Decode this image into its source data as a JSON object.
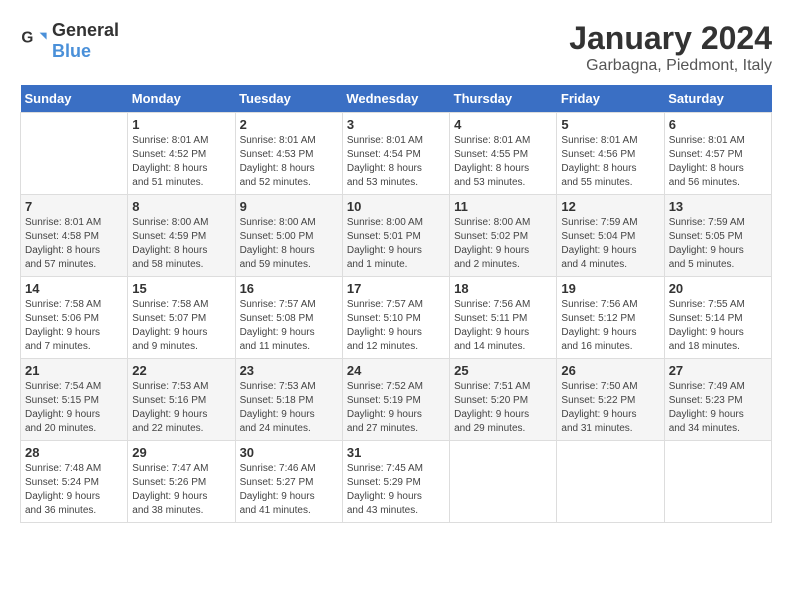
{
  "header": {
    "logo_general": "General",
    "logo_blue": "Blue",
    "month_title": "January 2024",
    "location": "Garbagna, Piedmont, Italy"
  },
  "weekdays": [
    "Sunday",
    "Monday",
    "Tuesday",
    "Wednesday",
    "Thursday",
    "Friday",
    "Saturday"
  ],
  "weeks": [
    [
      {
        "day": "",
        "info": ""
      },
      {
        "day": "1",
        "info": "Sunrise: 8:01 AM\nSunset: 4:52 PM\nDaylight: 8 hours\nand 51 minutes."
      },
      {
        "day": "2",
        "info": "Sunrise: 8:01 AM\nSunset: 4:53 PM\nDaylight: 8 hours\nand 52 minutes."
      },
      {
        "day": "3",
        "info": "Sunrise: 8:01 AM\nSunset: 4:54 PM\nDaylight: 8 hours\nand 53 minutes."
      },
      {
        "day": "4",
        "info": "Sunrise: 8:01 AM\nSunset: 4:55 PM\nDaylight: 8 hours\nand 53 minutes."
      },
      {
        "day": "5",
        "info": "Sunrise: 8:01 AM\nSunset: 4:56 PM\nDaylight: 8 hours\nand 55 minutes."
      },
      {
        "day": "6",
        "info": "Sunrise: 8:01 AM\nSunset: 4:57 PM\nDaylight: 8 hours\nand 56 minutes."
      }
    ],
    [
      {
        "day": "7",
        "info": "Sunrise: 8:01 AM\nSunset: 4:58 PM\nDaylight: 8 hours\nand 57 minutes."
      },
      {
        "day": "8",
        "info": "Sunrise: 8:00 AM\nSunset: 4:59 PM\nDaylight: 8 hours\nand 58 minutes."
      },
      {
        "day": "9",
        "info": "Sunrise: 8:00 AM\nSunset: 5:00 PM\nDaylight: 8 hours\nand 59 minutes."
      },
      {
        "day": "10",
        "info": "Sunrise: 8:00 AM\nSunset: 5:01 PM\nDaylight: 9 hours\nand 1 minute."
      },
      {
        "day": "11",
        "info": "Sunrise: 8:00 AM\nSunset: 5:02 PM\nDaylight: 9 hours\nand 2 minutes."
      },
      {
        "day": "12",
        "info": "Sunrise: 7:59 AM\nSunset: 5:04 PM\nDaylight: 9 hours\nand 4 minutes."
      },
      {
        "day": "13",
        "info": "Sunrise: 7:59 AM\nSunset: 5:05 PM\nDaylight: 9 hours\nand 5 minutes."
      }
    ],
    [
      {
        "day": "14",
        "info": "Sunrise: 7:58 AM\nSunset: 5:06 PM\nDaylight: 9 hours\nand 7 minutes."
      },
      {
        "day": "15",
        "info": "Sunrise: 7:58 AM\nSunset: 5:07 PM\nDaylight: 9 hours\nand 9 minutes."
      },
      {
        "day": "16",
        "info": "Sunrise: 7:57 AM\nSunset: 5:08 PM\nDaylight: 9 hours\nand 11 minutes."
      },
      {
        "day": "17",
        "info": "Sunrise: 7:57 AM\nSunset: 5:10 PM\nDaylight: 9 hours\nand 12 minutes."
      },
      {
        "day": "18",
        "info": "Sunrise: 7:56 AM\nSunset: 5:11 PM\nDaylight: 9 hours\nand 14 minutes."
      },
      {
        "day": "19",
        "info": "Sunrise: 7:56 AM\nSunset: 5:12 PM\nDaylight: 9 hours\nand 16 minutes."
      },
      {
        "day": "20",
        "info": "Sunrise: 7:55 AM\nSunset: 5:14 PM\nDaylight: 9 hours\nand 18 minutes."
      }
    ],
    [
      {
        "day": "21",
        "info": "Sunrise: 7:54 AM\nSunset: 5:15 PM\nDaylight: 9 hours\nand 20 minutes."
      },
      {
        "day": "22",
        "info": "Sunrise: 7:53 AM\nSunset: 5:16 PM\nDaylight: 9 hours\nand 22 minutes."
      },
      {
        "day": "23",
        "info": "Sunrise: 7:53 AM\nSunset: 5:18 PM\nDaylight: 9 hours\nand 24 minutes."
      },
      {
        "day": "24",
        "info": "Sunrise: 7:52 AM\nSunset: 5:19 PM\nDaylight: 9 hours\nand 27 minutes."
      },
      {
        "day": "25",
        "info": "Sunrise: 7:51 AM\nSunset: 5:20 PM\nDaylight: 9 hours\nand 29 minutes."
      },
      {
        "day": "26",
        "info": "Sunrise: 7:50 AM\nSunset: 5:22 PM\nDaylight: 9 hours\nand 31 minutes."
      },
      {
        "day": "27",
        "info": "Sunrise: 7:49 AM\nSunset: 5:23 PM\nDaylight: 9 hours\nand 34 minutes."
      }
    ],
    [
      {
        "day": "28",
        "info": "Sunrise: 7:48 AM\nSunset: 5:24 PM\nDaylight: 9 hours\nand 36 minutes."
      },
      {
        "day": "29",
        "info": "Sunrise: 7:47 AM\nSunset: 5:26 PM\nDaylight: 9 hours\nand 38 minutes."
      },
      {
        "day": "30",
        "info": "Sunrise: 7:46 AM\nSunset: 5:27 PM\nDaylight: 9 hours\nand 41 minutes."
      },
      {
        "day": "31",
        "info": "Sunrise: 7:45 AM\nSunset: 5:29 PM\nDaylight: 9 hours\nand 43 minutes."
      },
      {
        "day": "",
        "info": ""
      },
      {
        "day": "",
        "info": ""
      },
      {
        "day": "",
        "info": ""
      }
    ]
  ]
}
